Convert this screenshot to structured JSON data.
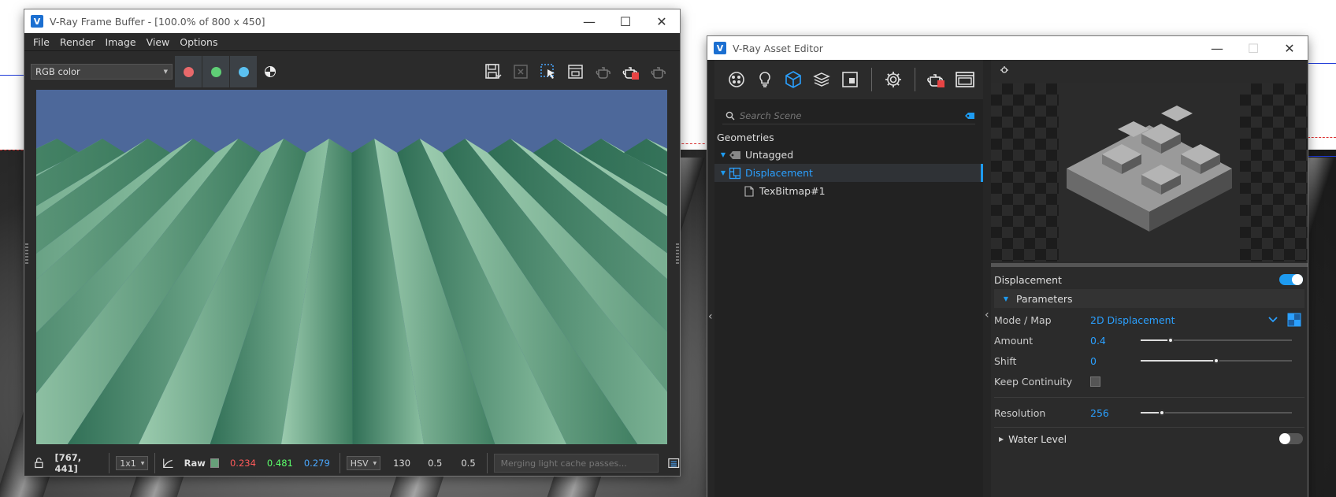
{
  "vfb": {
    "title": "V-Ray Frame Buffer - [100.0% of 800 x 450]",
    "menu": [
      "File",
      "Render",
      "Image",
      "View",
      "Options"
    ],
    "channel_select": "RGB color",
    "status": {
      "coords": "[767, 441]",
      "sampling": "1x1",
      "raw_label": "Raw",
      "r": "0.234",
      "g": "0.481",
      "b": "0.279",
      "color_mode": "HSV",
      "h": "130",
      "s": "0.5",
      "v": "0.5",
      "message": "Merging light cache passes..."
    }
  },
  "ae": {
    "title": "V-Ray Asset Editor",
    "search_placeholder": "Search Scene",
    "category": "Geometries",
    "tree": [
      {
        "label": "Untagged"
      },
      {
        "label": "Displacement",
        "selected": true
      },
      {
        "label": "TexBitmap#1"
      }
    ],
    "props": {
      "header": "Displacement",
      "header_enabled": true,
      "section": "Parameters",
      "mode_label": "Mode / Map",
      "mode_value": "2D Displacement",
      "amount_label": "Amount",
      "amount_value": "0.4",
      "amount_level": 0.2,
      "shift_label": "Shift",
      "shift_value": "0",
      "shift_level": 0.5,
      "keep_label": "Keep Continuity",
      "keep_checked": false,
      "res_label": "Resolution",
      "res_value": "256",
      "res_level": 0.14,
      "water_label": "Water Level",
      "water_enabled": false
    }
  },
  "colors": {
    "accent": "#1e9bf0",
    "red": "#e8696b",
    "green": "#5fcf76",
    "blue": "#5bc0f0",
    "r_text": "#ff5a5a",
    "g_text": "#5cff6b",
    "b_text": "#4aa8ff"
  }
}
